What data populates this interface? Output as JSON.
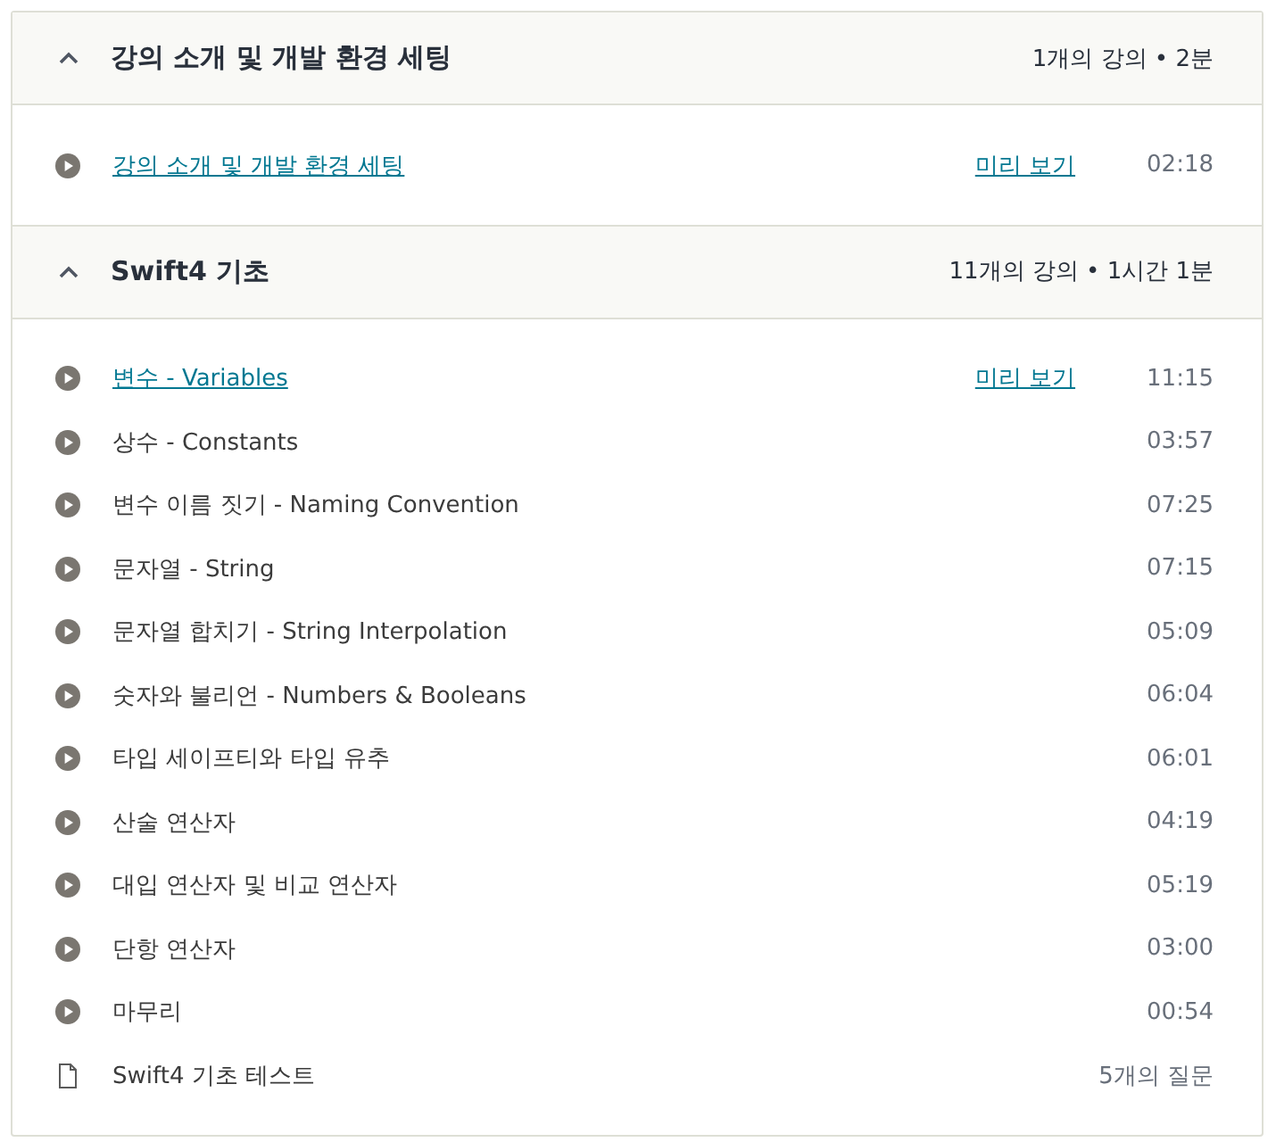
{
  "sections": [
    {
      "title": "강의 소개 및 개발 환경 세팅",
      "meta": "1개의 강의 • 2분",
      "expanded": true,
      "items": [
        {
          "kind": "video",
          "title": "강의 소개 및 개발 환경 세팅",
          "preview": "미리 보기",
          "duration": "02:18"
        }
      ]
    },
    {
      "title": "Swift4 기초",
      "meta": "11개의 강의 • 1시간 1분",
      "expanded": true,
      "items": [
        {
          "kind": "video",
          "title": "변수 - Variables",
          "preview": "미리 보기",
          "duration": "11:15"
        },
        {
          "kind": "video",
          "title": "상수 - Constants",
          "duration": "03:57"
        },
        {
          "kind": "video",
          "title": "변수 이름 짓기 - Naming Convention",
          "duration": "07:25"
        },
        {
          "kind": "video",
          "title": "문자열 - String",
          "duration": "07:15"
        },
        {
          "kind": "video",
          "title": "문자열 합치기 - String Interpolation",
          "duration": "05:09"
        },
        {
          "kind": "video",
          "title": "숫자와 불리언 - Numbers & Booleans",
          "duration": "06:04"
        },
        {
          "kind": "video",
          "title": "타입 세이프티와 타입 유추",
          "duration": "06:01"
        },
        {
          "kind": "video",
          "title": "산술 연산자",
          "duration": "04:19"
        },
        {
          "kind": "video",
          "title": "대입 연산자 및 비교 연산자",
          "duration": "05:19"
        },
        {
          "kind": "video",
          "title": "단항 연산자",
          "duration": "03:00"
        },
        {
          "kind": "video",
          "title": "마무리",
          "duration": "00:54"
        },
        {
          "kind": "quiz",
          "title": "Swift4 기초 테스트",
          "duration": "5개의 질문"
        }
      ]
    }
  ]
}
